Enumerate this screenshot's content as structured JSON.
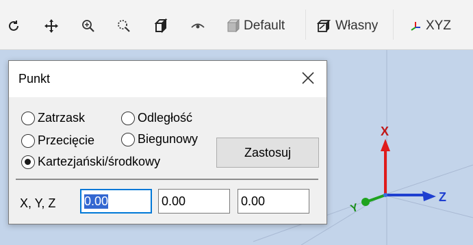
{
  "toolbar": {
    "buttons": [
      {
        "icon": "rotate-icon"
      },
      {
        "icon": "pan-icon"
      },
      {
        "icon": "zoom-icon"
      },
      {
        "icon": "zoom-window-icon"
      },
      {
        "icon": "cube-view-icon"
      },
      {
        "icon": "eye-icon"
      },
      {
        "icon": "default-view-icon",
        "label": "Default"
      },
      {
        "icon": "custom-view-icon",
        "label": "Własny"
      },
      {
        "icon": "xyz-axes-icon",
        "label": "XYZ"
      }
    ]
  },
  "dialog": {
    "title": "Punkt",
    "radios": {
      "snap": "Zatrzask",
      "distance": "Odległość",
      "intersection": "Przecięcie",
      "polar": "Biegunowy",
      "cartesian": "Kartezjański/środkowy"
    },
    "selected_radio": "cartesian",
    "apply_label": "Zastosuj",
    "coords_label": "X, Y, Z",
    "coords": {
      "x": "0.00",
      "y": "0.00",
      "z": "0.00"
    }
  },
  "axes": {
    "x": "X",
    "y": "Y",
    "z": "Z"
  },
  "colors": {
    "x_axis": "#e01b1b",
    "y_axis": "#1fa31f",
    "z_axis": "#1e3fd0",
    "accent": "#0078d7"
  }
}
